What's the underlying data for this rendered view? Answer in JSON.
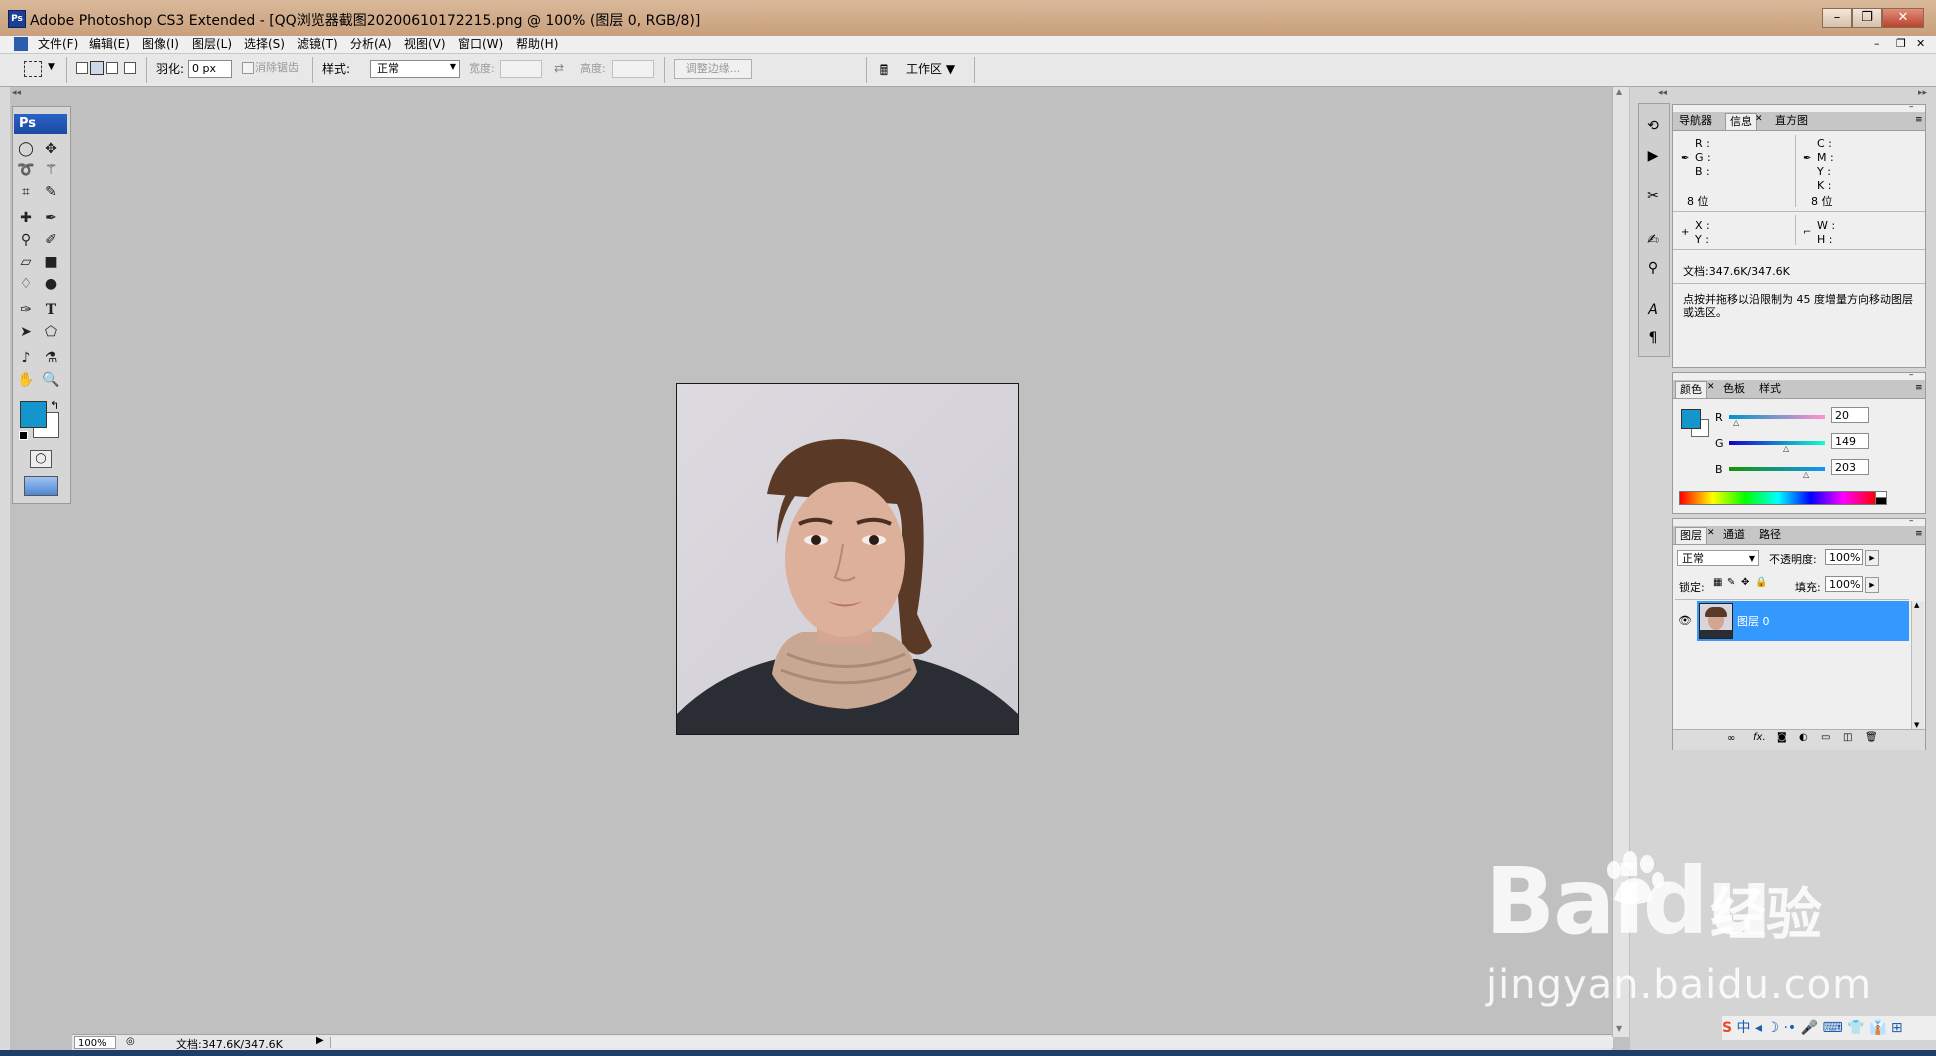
{
  "window": {
    "title": "Adobe Photoshop CS3 Extended - [QQ浏览器截图20200610172215.png @ 100% (图层 0, RGB/8)]"
  },
  "menu": [
    "文件(F)",
    "编辑(E)",
    "图像(I)",
    "图层(L)",
    "选择(S)",
    "滤镜(T)",
    "分析(A)",
    "视图(V)",
    "窗口(W)",
    "帮助(H)"
  ],
  "options": {
    "feather_label": "羽化:",
    "feather_value": "0 px",
    "antialias_label": "消除锯齿",
    "style_label": "样式:",
    "style_value": "正常",
    "width_label": "宽度:",
    "height_label": "高度:",
    "refine_label": "调整边缘...",
    "workspace_label": "工作区"
  },
  "toolbox": {
    "logo": "Ps",
    "fg_color": "#1495cb",
    "bg_color": "#ffffff"
  },
  "info_panel": {
    "tabs": [
      "导航器",
      "信息",
      "直方图"
    ],
    "rgb_labels": [
      "R :",
      "G :",
      "B :"
    ],
    "cmyk_labels": [
      "C :",
      "M :",
      "Y :",
      "K :"
    ],
    "bits_left": "8 位",
    "bits_right": "8 位",
    "xy_labels": [
      "X :",
      "Y :"
    ],
    "wh_labels": [
      "W :",
      "H :"
    ],
    "doc": "文档:347.6K/347.6K",
    "hint": "点按并拖移以沿限制为 45 度增量方向移动图层或选区。"
  },
  "color_panel": {
    "tabs": [
      "颜色",
      "色板",
      "样式"
    ],
    "channels": [
      {
        "name": "R",
        "value": "20"
      },
      {
        "name": "G",
        "value": "149"
      },
      {
        "name": "B",
        "value": "203"
      }
    ]
  },
  "layers_panel": {
    "tabs": [
      "图层",
      "通道",
      "路径"
    ],
    "blend_mode": "正常",
    "opacity_label": "不透明度:",
    "opacity_value": "100%",
    "lock_label": "锁定:",
    "fill_label": "填充:",
    "fill_value": "100%",
    "layer_name": "图层 0"
  },
  "status": {
    "zoom": "100%",
    "doc": "文档:347.6K/347.6K"
  },
  "watermark": {
    "brand": "Bai",
    "brand2": "du",
    "cn": "经验",
    "url": "jingyan.baidu.com"
  }
}
